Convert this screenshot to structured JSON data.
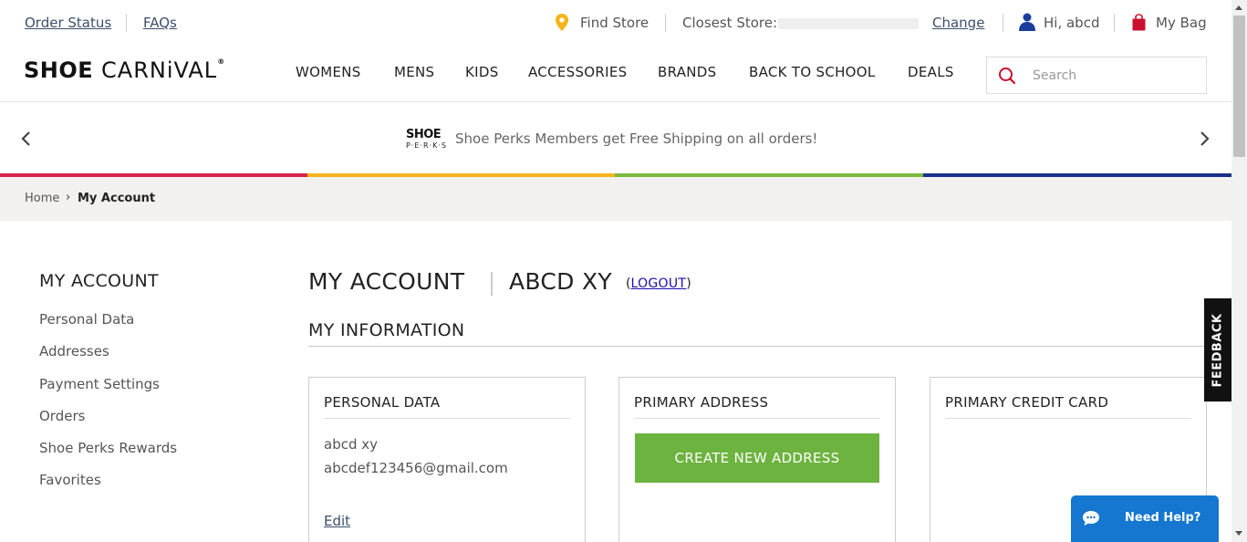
{
  "util": {
    "order_status": "Order Status",
    "faqs": "FAQs",
    "find_store": "Find Store",
    "closest_store_label": "Closest Store:",
    "change": "Change",
    "greeting": "Hi, abcd",
    "bag": "My Bag"
  },
  "header": {
    "logo_part1": "SHOE",
    "logo_part2": "CARNiVAL",
    "logo_reg": "®",
    "nav": [
      "WOMENS",
      "MENS",
      "KIDS",
      "ACCESSORIES",
      "BRANDS",
      "BACK TO SCHOOL",
      "DEALS"
    ],
    "search_placeholder": "Search"
  },
  "promo": {
    "logo_top": "SHOE",
    "logo_bottom": "P·E·R·K·S",
    "text": "Shoe Perks Members get Free Shipping on all orders!"
  },
  "breadcrumb": {
    "home": "Home",
    "separator": "›",
    "current": "My Account"
  },
  "sidebar": {
    "title": "MY ACCOUNT",
    "items": [
      "Personal Data",
      "Addresses",
      "Payment Settings",
      "Orders",
      "Shoe Perks Rewards",
      "Favorites"
    ]
  },
  "main": {
    "title": "MY ACCOUNT",
    "name": "ABCD XY",
    "logout_open": "(",
    "logout": "LOGOUT",
    "logout_close": ")",
    "info_title": "MY INFORMATION",
    "cards": {
      "personal": {
        "title": "PERSONAL DATA",
        "name": "abcd xy",
        "email": "abcdef123456@gmail.com",
        "edit": "Edit"
      },
      "address": {
        "title": "PRIMARY ADDRESS",
        "button": "CREATE NEW ADDRESS"
      },
      "card": {
        "title": "PRIMARY CREDIT CARD"
      }
    }
  },
  "feedback": "FEEDBACK",
  "help": "Need Help?",
  "colors": {
    "accent_green": "#6db33f",
    "help_blue": "#1577d0",
    "stripe_red": "#d9214c",
    "stripe_yellow": "#f5b51a",
    "stripe_green": "#7ab93f",
    "stripe_blue": "#1a2f8a",
    "pin_yellow": "#f4b31a",
    "bag_red": "#c8102e",
    "user_blue": "#1a3d9c"
  },
  "icons": {
    "find_store": "map-pin-icon",
    "user": "user-icon",
    "bag": "shopping-bag-icon",
    "search": "search-icon",
    "prev": "chevron-left-icon",
    "next": "chevron-right-icon",
    "chat": "chat-bubble-icon"
  }
}
